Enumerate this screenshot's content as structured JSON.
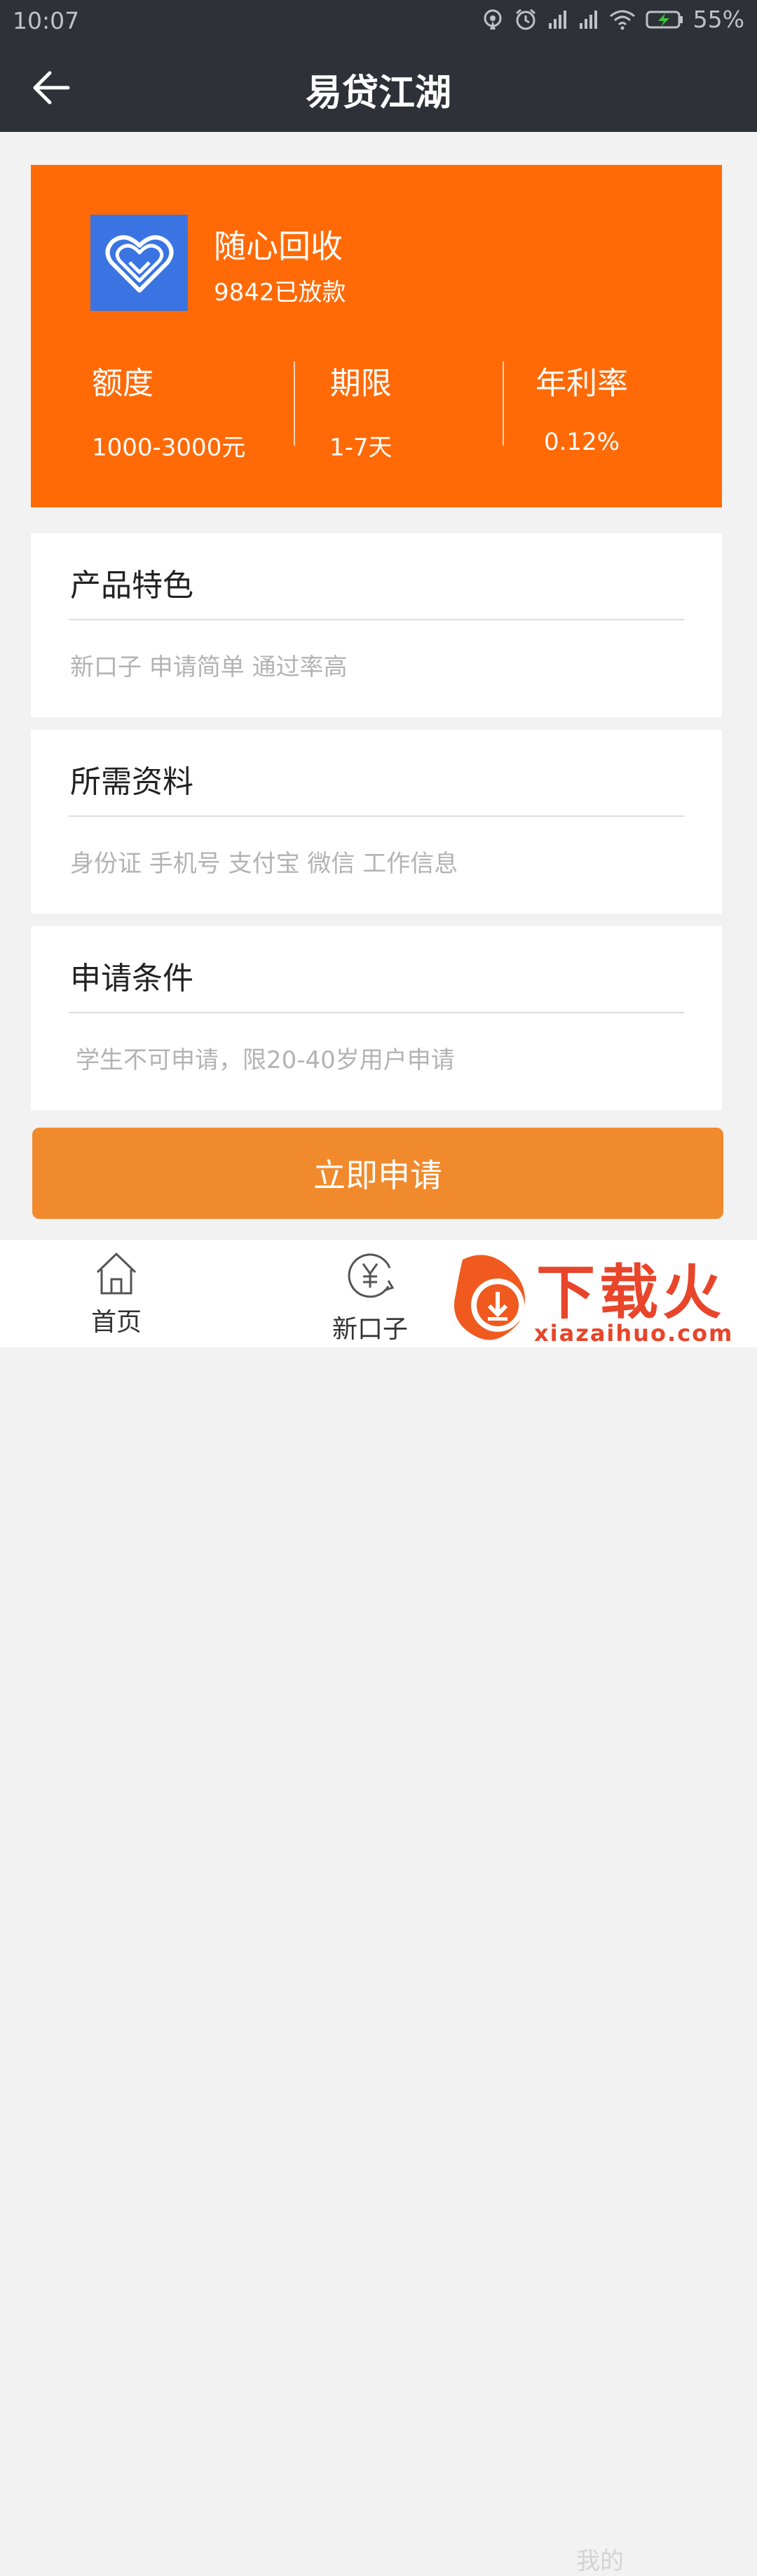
{
  "status_bar": {
    "time": "10:07",
    "battery": "55%"
  },
  "header": {
    "title": "易贷江湖"
  },
  "product": {
    "name": "随心回收",
    "disbursed": "9842已放款",
    "stats": [
      {
        "label": "额度",
        "value": "1000-3000元"
      },
      {
        "label": "期限",
        "value": "1-7天"
      },
      {
        "label": "年利率",
        "value": "0.12%"
      }
    ],
    "colors": {
      "hero_bg": "#ff6a07",
      "logo_bg": "#3a74e3"
    }
  },
  "sections": [
    {
      "heading": "产品特色",
      "text": "新口子 申请简单 通过率高"
    },
    {
      "heading": "所需资料",
      "text": "身份证 手机号 支付宝 微信 工作信息"
    },
    {
      "heading": "申请条件",
      "text": "学生不可申请，限20-40岁用户申请"
    }
  ],
  "apply_button": {
    "label": "立即申请",
    "color": "#f08a2c"
  },
  "tabbar": {
    "items": [
      {
        "label": "首页",
        "icon": "home-icon"
      },
      {
        "label": "新口子",
        "icon": "yen-refresh-icon"
      },
      {
        "label": "我的",
        "icon": "user-icon"
      }
    ]
  },
  "watermark": {
    "brand": "下载火",
    "url": "xiazaihuo.com"
  }
}
